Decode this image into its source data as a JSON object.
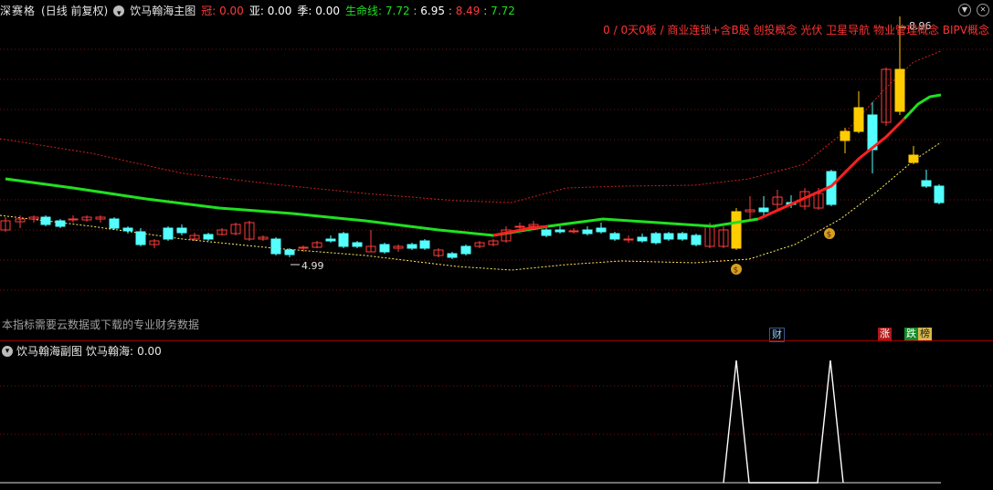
{
  "header": {
    "stock_name": "深赛格",
    "period_label": "(日线 前复权)",
    "indicator_name": "饮马翰海主图",
    "guan": {
      "label": "冠:",
      "value": "0.00"
    },
    "ya": {
      "label": "亚:",
      "value": "0.00"
    },
    "ji": {
      "label": "季:",
      "value": "0.00"
    },
    "lifeline": {
      "label": "生命线:",
      "values": [
        "7.72",
        "6.95",
        "8.49",
        "7.72"
      ]
    }
  },
  "concept_strip": "0 / 0天0板 / 商业连锁+含B股 创投概念 光伏 卫星导航 物业管理概念 BIPV概念",
  "price_labels": {
    "high": "8.96",
    "low": "4.99"
  },
  "notice": "本指标需要云数据或下载的专业财务数据",
  "tags": {
    "cai": "财",
    "zhang": "涨",
    "die": "跌",
    "bang": "榜"
  },
  "sub_panel": {
    "indicator_name": "饮马翰海副图",
    "value_label": "饮马翰海:",
    "value": "0.00"
  },
  "colors": {
    "background": "#000000",
    "up_candle": "#ff3b3b",
    "down_candle": "#54ffff",
    "signal_candle": "#ffcc00",
    "lifeline_up": "#ff2020",
    "lifeline_down": "#20e020",
    "upper_band": "#cc2020",
    "lower_band": "#ffee66",
    "grid": "#7a1010"
  }
}
